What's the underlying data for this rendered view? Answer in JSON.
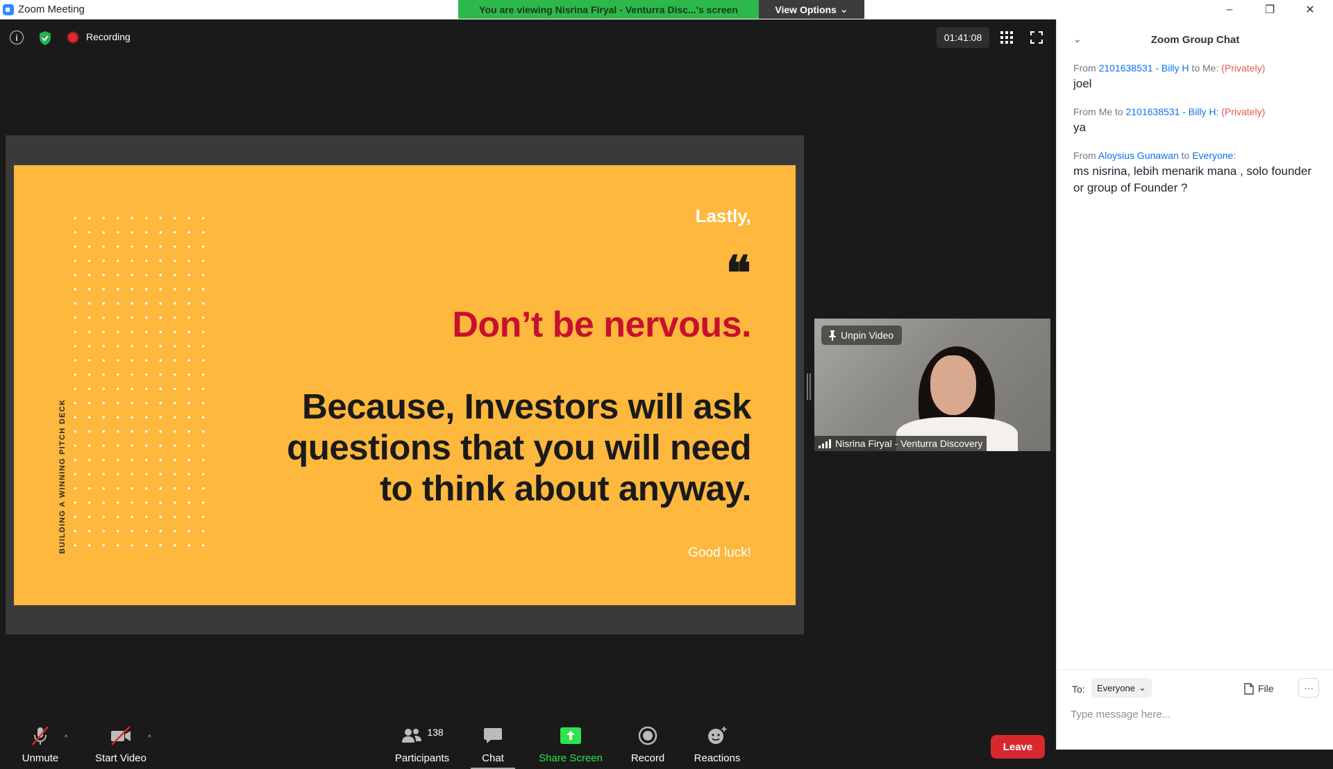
{
  "window": {
    "title": "Zoom Meeting",
    "minimize": "–",
    "restore": "❐",
    "close": "✕"
  },
  "banner": {
    "viewing_text": "You are viewing Nisrina Firyal - Venturra Disc...'s screen",
    "view_options_label": "View Options",
    "view_options_caret": "⌄"
  },
  "top_bar": {
    "info_glyph": "i",
    "recording_label": "Recording",
    "timer": "01:41:08"
  },
  "slide": {
    "vertical_label": "BUILDING A WINNING PITCH DECK",
    "lastly": "Lastly,",
    "quote_mark": "❝",
    "headline": "Don’t be nervous.",
    "body": "Because, Investors will ask questions that you will need to think about anyway.",
    "footer": "Good luck!",
    "background_color": "#fdb83d",
    "headline_color": "#c8102e"
  },
  "video": {
    "pin_label": "Unpin Video",
    "participant_name": "Nisrina Firyal - Venturra Discovery"
  },
  "toolbar": {
    "unmute_label": "Unmute",
    "start_video_label": "Start Video",
    "participants_label": "Participants",
    "participants_count": "138",
    "chat_label": "Chat",
    "share_screen_label": "Share Screen",
    "record_label": "Record",
    "reactions_label": "Reactions",
    "leave_label": "Leave",
    "caret": "^"
  },
  "chat": {
    "title": "Zoom Group Chat",
    "collapse_glyph": "⌄",
    "messages": [
      {
        "from_prefix": "From ",
        "sender": "2101638531 - Billy H",
        "to_prefix": " to ",
        "recipient": "Me:",
        "privacy": "(Privately)",
        "text": "joel"
      },
      {
        "from_prefix": "From ",
        "sender": "Me",
        "to_prefix": " to ",
        "recipient": "2101638531 - Billy H:",
        "privacy": "(Privately)",
        "text": "ya"
      },
      {
        "from_prefix": "From ",
        "sender": "Aloysius Gunawan",
        "to_prefix": " to ",
        "recipient": "Everyone:",
        "privacy": "",
        "text": "ms nisrina, lebih menarik mana  , solo founder or group of Founder ?"
      }
    ],
    "to_label": "To:",
    "to_value": "Everyone",
    "file_label": "File",
    "more_glyph": "···",
    "input_placeholder": "Type message here..."
  },
  "colors": {
    "share_green": "#2ee34d",
    "banner_green": "#2db84c",
    "leave_red": "#d9272e",
    "link_blue": "#0e72ed",
    "private_red": "#e8554e"
  }
}
